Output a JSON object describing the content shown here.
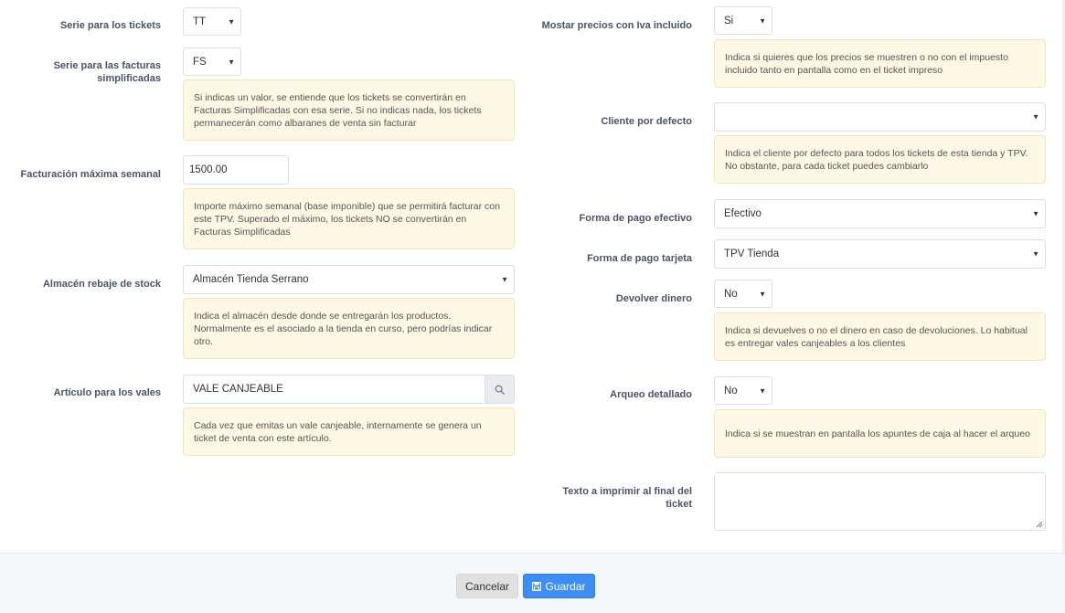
{
  "left": {
    "serie_tickets": {
      "label": "Serie para los tickets",
      "value": "TT"
    },
    "serie_facturas": {
      "label_line1": "Serie para las facturas",
      "label_line2": "simplificadas",
      "value": "FS",
      "help": "Si indicas un valor, se entiende que los tickets se convertirán en Facturas Simplificadas con esa serie. Si no indicas nada, los tickets permanecerán como albaranes de venta sin facturar"
    },
    "facturacion_maxima": {
      "label": "Facturación máxima semanal",
      "value": "1500.00",
      "help": "Importe máximo semanal (base imponible) que se permitirá facturar con este TPV. Superado el máximo, los tickets NO se convertirán en Facturas Simplificadas"
    },
    "almacen": {
      "label": "Almacén rebaje de stock",
      "value": "Almacén Tienda Serrano",
      "help": "Indica el almacén desde donde se entregarán los productos. Normalmente es el asociado a la tienda en curso, pero podrías indicar otro."
    },
    "articulo_vales": {
      "label": "Artículo para los vales",
      "value": "VALE CANJEABLE",
      "help": "Cada vez que emitas un vale canjeable, internamente se genera un ticket de venta con este artículo."
    }
  },
  "right": {
    "precios_iva": {
      "label": "Mostar precios con Iva incluido",
      "value": "Si",
      "help": "Indica si quieres que los precios se muestren o no con el impuesto incluido tanto en pantalla como en el ticket impreso"
    },
    "cliente_defecto": {
      "label": "Cliente por defecto",
      "value": "",
      "help": "Indica el cliente por defecto para todos los tickets de esta tienda y TPV. No obstante, para cada ticket puedes cambiarlo"
    },
    "pago_efectivo": {
      "label": "Forma de pago efectivo",
      "value": "Efectivo"
    },
    "pago_tarjeta": {
      "label": "Forma de pago tarjeta",
      "value": "TPV Tienda"
    },
    "devolver_dinero": {
      "label": "Devolver dinero",
      "value": "No",
      "help": "Indica si devuelves o no el dinero en caso de devoluciones. Lo habitual es entregar vales canjeables a los clientes"
    },
    "arqueo_detallado": {
      "label": "Arqueo detallado",
      "value": "No",
      "help": "Indica si se muestran en pantalla los apuntes de caja al hacer el arqueo"
    },
    "texto_final": {
      "label_line1": "Texto a imprimir al final del",
      "label_line2": "ticket",
      "value": ""
    }
  },
  "footer": {
    "cancel_label": "Cancelar",
    "save_label": "Guardar"
  },
  "icons": {
    "caret": "caret-down-icon",
    "search": "search-icon",
    "save": "floppy-disk-icon"
  },
  "colors": {
    "primary": "#3d8ef4",
    "help_bg": "#fcf8e3",
    "label": "#4a5366"
  }
}
